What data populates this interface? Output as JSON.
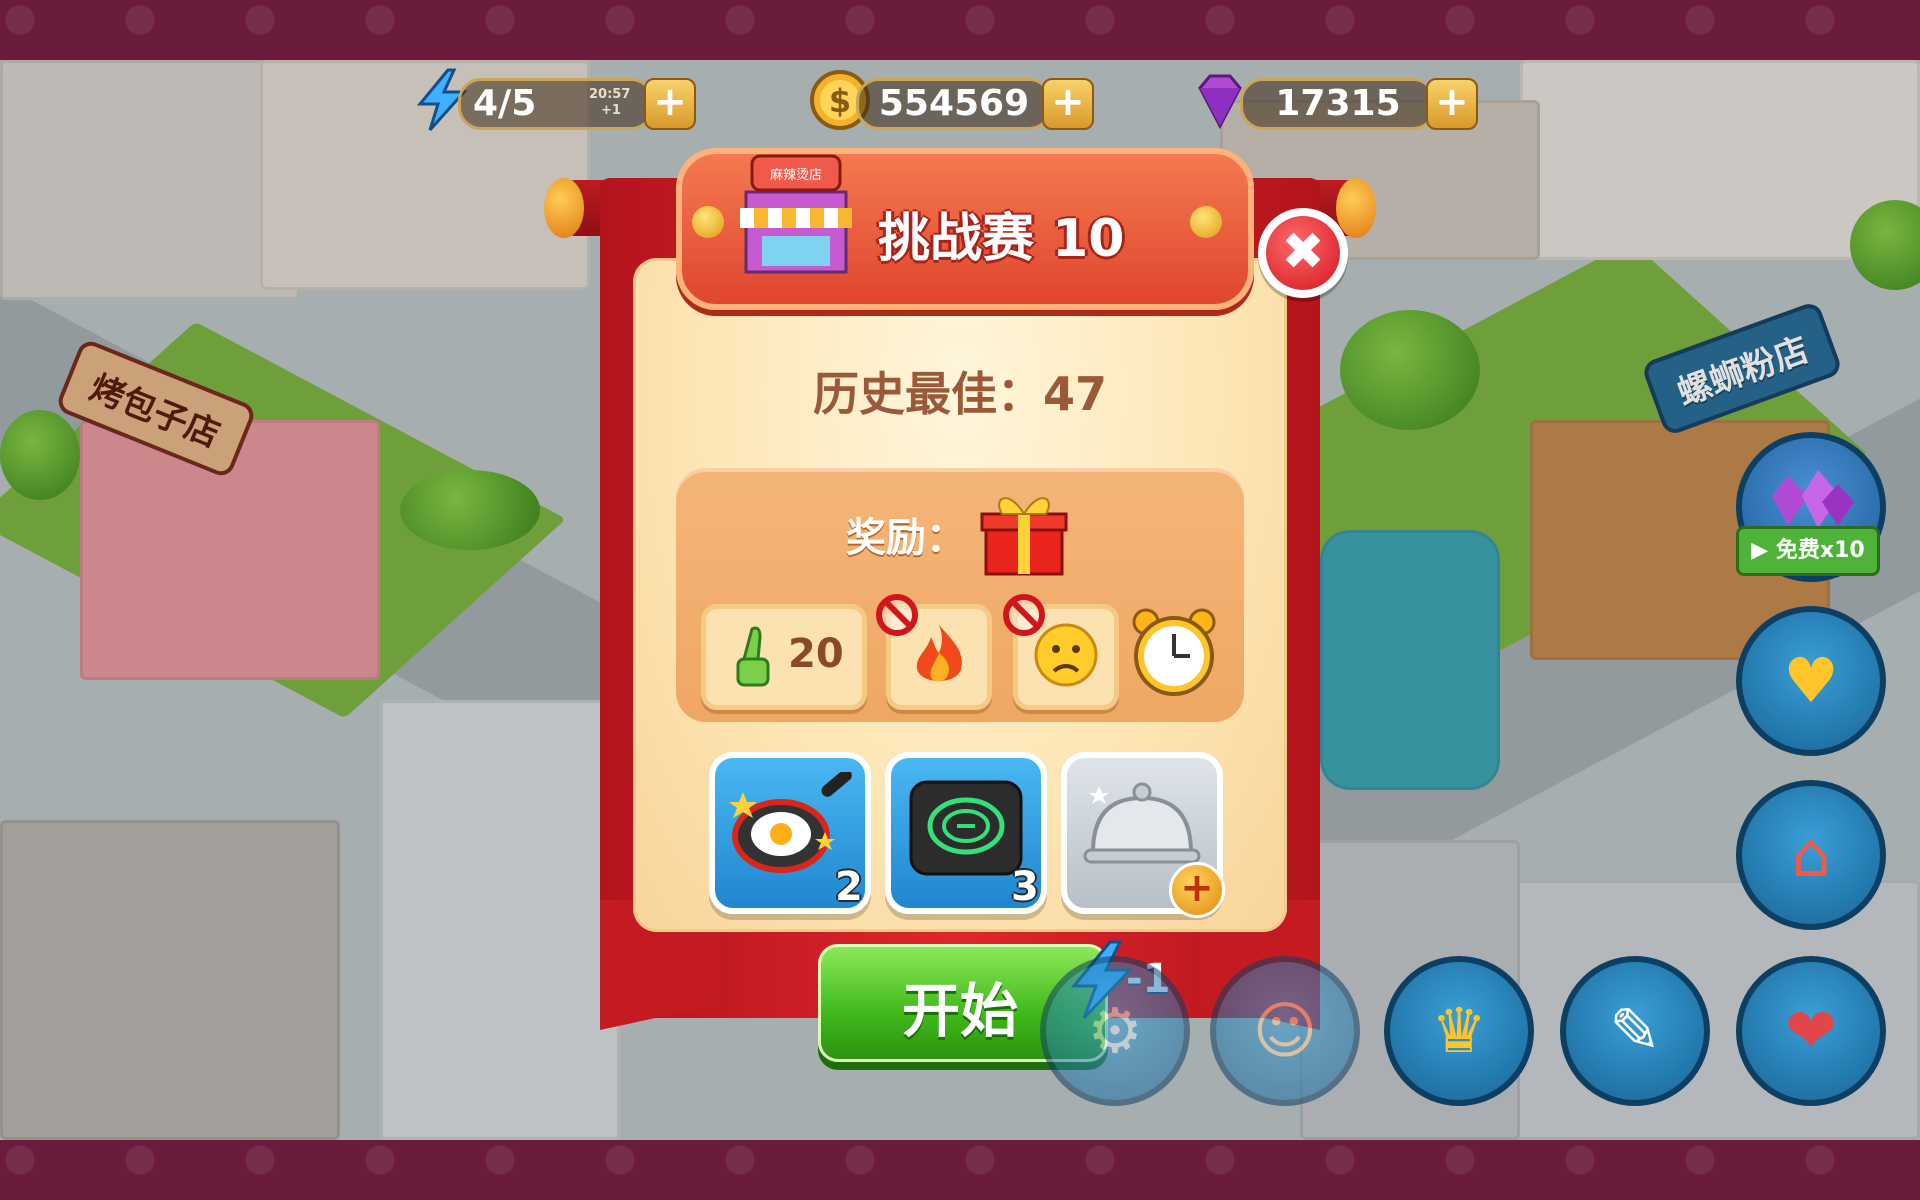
{
  "resources": {
    "energy": {
      "value": "4/5",
      "timer": "20:57",
      "regen": "+1"
    },
    "coins": {
      "value": "554569"
    },
    "gems": {
      "value": "17315"
    },
    "plus": "+"
  },
  "scene": {
    "shop_left": "烤包子店",
    "shop_right": "螺蛳粉店",
    "shop_icon_sign": "麻辣烫店"
  },
  "dialog": {
    "title": "挑战赛 10",
    "close_glyph": "✖",
    "best_label": "历史最佳：47",
    "reward_label": "奖励：",
    "conditions": {
      "likes_value": "20"
    },
    "boosters": [
      {
        "name": "egg-pan",
        "count": "2"
      },
      {
        "name": "induction-cooker",
        "count": "3"
      },
      {
        "name": "food-cloche",
        "count": "+"
      }
    ],
    "start_label": "开始",
    "energy_cost": "-1"
  },
  "side": {
    "free_label": "免费x10"
  },
  "colors": {
    "accent_red": "#d2161e",
    "start_green": "#3fb81a",
    "panel_cream": "#fde6b6",
    "frame_maroon": "#6b1c3c"
  }
}
